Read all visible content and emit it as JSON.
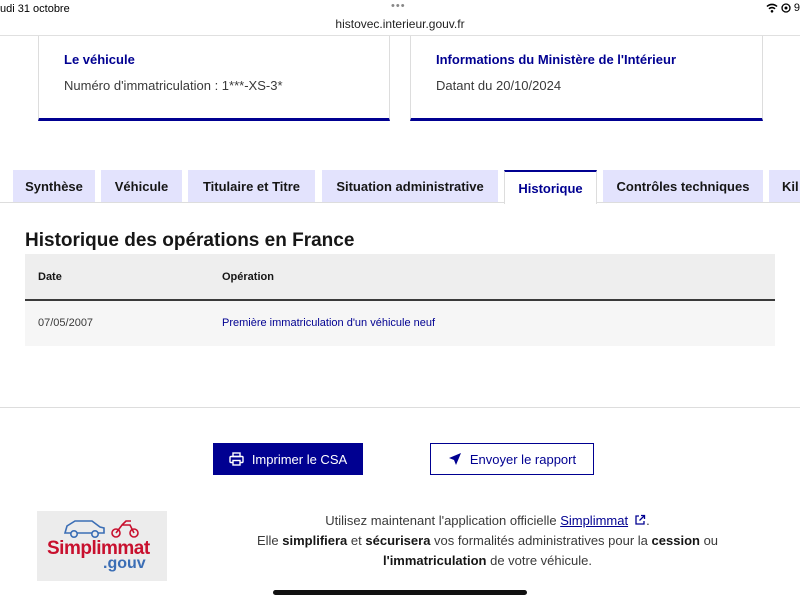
{
  "status_bar": {
    "date": "udi 31 octobre",
    "url": "histovec.interieur.gouv.fr",
    "battery_glyph": "9"
  },
  "cards": {
    "vehicle": {
      "title": "Le véhicule",
      "text": "Numéro d'immatriculation : 1***-XS-3*"
    },
    "ministry": {
      "title": "Informations du Ministère de l'Intérieur",
      "text": "Datant du 20/10/2024"
    }
  },
  "tabs": [
    {
      "label": "Synthèse"
    },
    {
      "label": "Véhicule"
    },
    {
      "label": "Titulaire et Titre"
    },
    {
      "label": "Situation administrative"
    },
    {
      "label": "Historique",
      "active": true
    },
    {
      "label": "Contrôles techniques"
    },
    {
      "label": "Kil"
    }
  ],
  "history": {
    "title": "Historique des opérations en France",
    "columns": [
      "Date",
      "Opération"
    ],
    "rows": [
      {
        "date": "07/05/2007",
        "operation": "Première immatriculation d'un véhicule neuf"
      }
    ]
  },
  "buttons": {
    "print": "Imprimer le CSA",
    "send": "Envoyer le rapport"
  },
  "promo": {
    "logo_main": "Simplimmat",
    "logo_sub": ".gouv",
    "line1_before": "Utilisez maintenant l'application officielle ",
    "line1_link": "Simplimmat",
    "line1_after": ".",
    "line2_a": "Elle ",
    "line2_b": "simplifiera",
    "line2_c": " et ",
    "line2_d": "sécurisera",
    "line2_e": " vos formalités administratives pour la ",
    "line2_f": "cession",
    "line2_g": " ou",
    "line3_a": "l'immatriculation",
    "line3_b": " de votre véhicule."
  },
  "colors": {
    "primary": "#000091",
    "tab_bg": "#e3e3fd",
    "logo_red": "#c8102e",
    "logo_blue": "#3b6eb5"
  },
  "icons": [
    "wifi-icon",
    "location-icon",
    "printer-icon",
    "send-arrow-icon",
    "external-link-icon",
    "car-icon",
    "motorbike-icon"
  ]
}
